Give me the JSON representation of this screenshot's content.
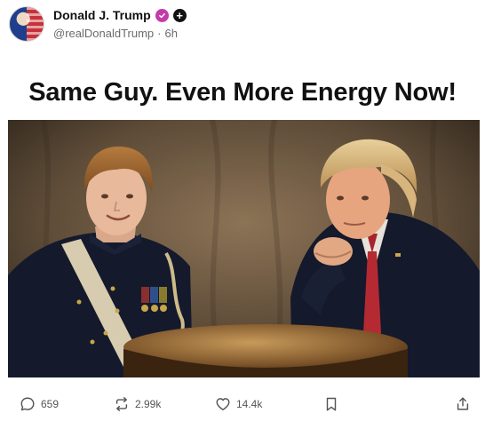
{
  "author": {
    "display_name": "Donald J. Trump",
    "handle": "@realDonaldTrump",
    "separator": "·",
    "time_ago": "6h",
    "follow_symbol": "+"
  },
  "post": {
    "headline": "Same Guy. Even More Energy Now!"
  },
  "actions": {
    "replies": "659",
    "reposts": "2.99k",
    "likes": "14.4k"
  },
  "colors": {
    "verified_badge": "#c13ca8",
    "text_primary": "#111111",
    "text_secondary": "#6b6b6b"
  },
  "icons": [
    "verified-badge-icon",
    "follow-plus-icon",
    "reply-icon",
    "repost-icon",
    "like-icon",
    "bookmark-icon",
    "share-icon"
  ]
}
